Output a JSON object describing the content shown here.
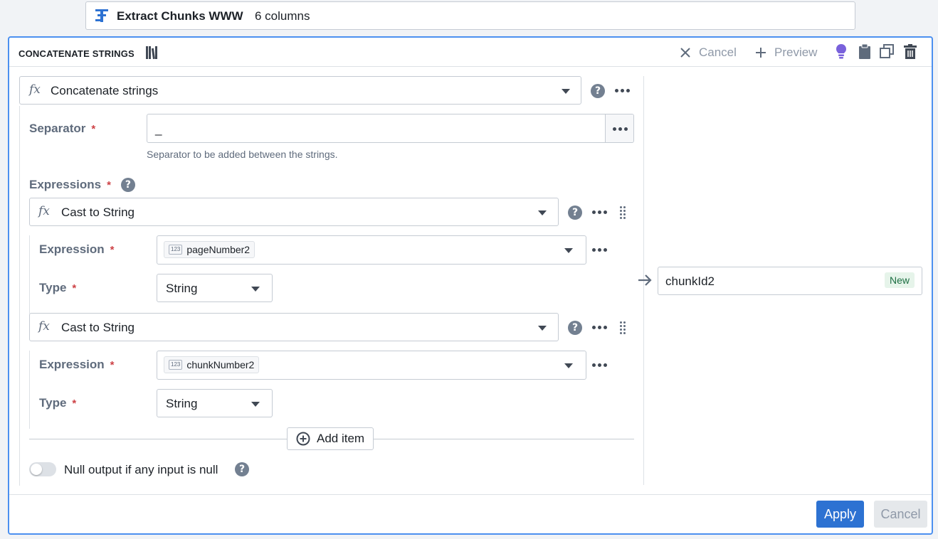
{
  "topbar": {
    "dataset_name": "Extract Chunks WWW",
    "columns": "6 columns"
  },
  "panel": {
    "title": "CONCATENATE STRINGS",
    "actions": {
      "cancel": "Cancel",
      "preview": "Preview"
    }
  },
  "function": {
    "name": "Concatenate strings"
  },
  "separator": {
    "label": "Separator",
    "value": "_",
    "help": "Separator to be added between the strings."
  },
  "expressions": {
    "label": "Expressions",
    "items": [
      {
        "function": "Cast to String",
        "expression_label": "Expression",
        "expression_value": "pageNumber2",
        "type_label": "Type",
        "type_value": "String",
        "type_icon": "123"
      },
      {
        "function": "Cast to String",
        "expression_label": "Expression",
        "expression_value": "chunkNumber2",
        "type_label": "Type",
        "type_value": "String",
        "type_icon": "123"
      }
    ],
    "add_item": "Add item"
  },
  "null_toggle": {
    "label": "Null output if any input is null"
  },
  "output": {
    "column": "chunkId2",
    "badge": "New"
  },
  "footer": {
    "apply": "Apply",
    "cancel": "Cancel"
  },
  "colors": {
    "accent": "#2d72d2",
    "border_focus": "#4c90f0",
    "required": "#cd4246",
    "new_badge": "#1c6e42",
    "bulb": "#7961db"
  }
}
